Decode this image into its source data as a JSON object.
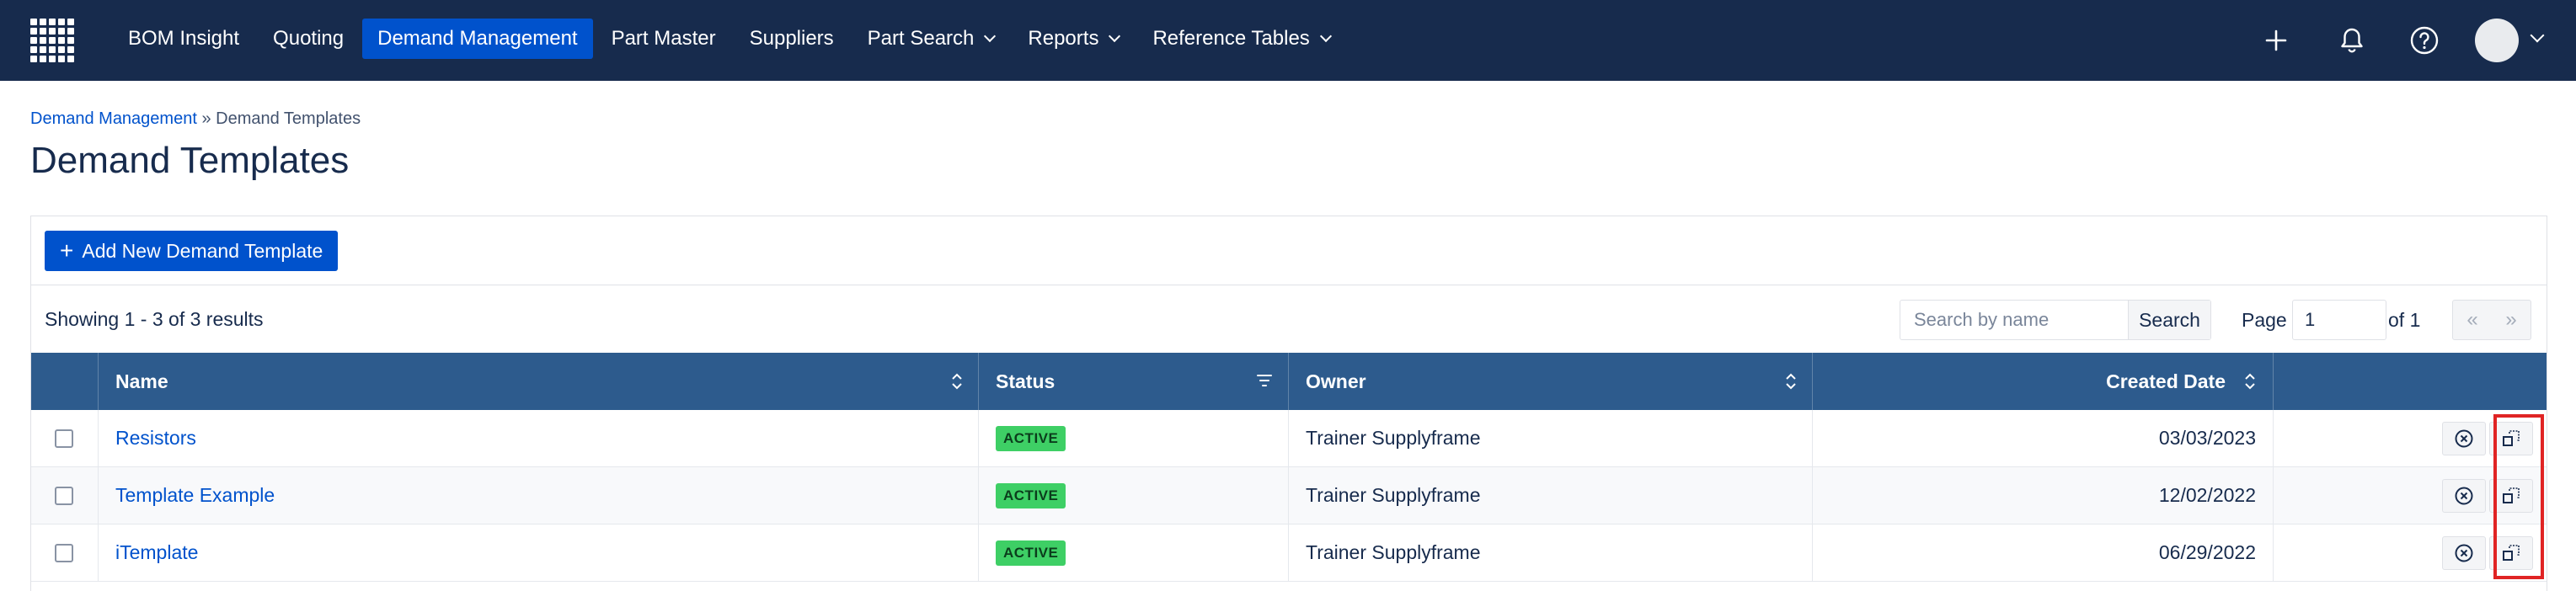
{
  "nav": {
    "items": [
      {
        "label": "BOM Insight",
        "dropdown": false,
        "active": false
      },
      {
        "label": "Quoting",
        "dropdown": false,
        "active": false
      },
      {
        "label": "Demand Management",
        "dropdown": false,
        "active": true
      },
      {
        "label": "Part Master",
        "dropdown": false,
        "active": false
      },
      {
        "label": "Suppliers",
        "dropdown": false,
        "active": false
      },
      {
        "label": "Part Search",
        "dropdown": true,
        "active": false
      },
      {
        "label": "Reports",
        "dropdown": true,
        "active": false
      },
      {
        "label": "Reference Tables",
        "dropdown": true,
        "active": false
      }
    ],
    "icons": [
      "plus-icon",
      "bell-icon",
      "help-icon",
      "avatar",
      "chevron-down-icon"
    ]
  },
  "breadcrumb": {
    "parent": "Demand Management",
    "separator": " » ",
    "current": "Demand Templates"
  },
  "page_title": "Demand Templates",
  "toolbar": {
    "add_plus": "+",
    "add_label": "Add New Demand Template"
  },
  "results": {
    "showing": "Showing 1 - 3 of 3 results",
    "search_placeholder": "Search by name",
    "search_button": "Search",
    "page_label": "Page",
    "page_value": "1",
    "page_of": "of 1",
    "prev": "«",
    "next": "»"
  },
  "table": {
    "headers": {
      "name": "Name",
      "status": "Status",
      "owner": "Owner",
      "created_date": "Created Date"
    },
    "rows": [
      {
        "name": "Resistors",
        "status": "ACTIVE",
        "owner": "Trainer Supplyframe",
        "created_date": "03/03/2023"
      },
      {
        "name": "Template Example",
        "status": "ACTIVE",
        "owner": "Trainer Supplyframe",
        "created_date": "12/02/2022"
      },
      {
        "name": "iTemplate",
        "status": "ACTIVE",
        "owner": "Trainer Supplyframe",
        "created_date": "06/29/2022"
      }
    ]
  },
  "colors": {
    "navbar": "#172b4d",
    "accent": "#0052cc",
    "table_header": "#2d5b8d",
    "status_active": "#3ecf65",
    "highlight": "#e02424"
  }
}
